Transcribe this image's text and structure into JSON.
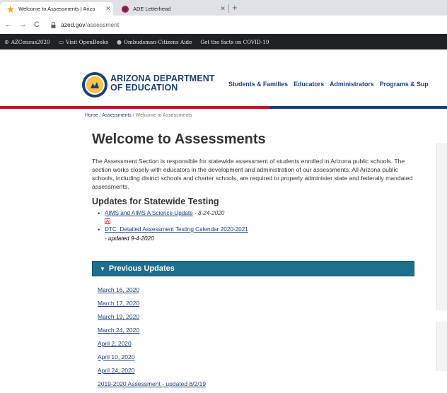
{
  "browser": {
    "tabs": [
      {
        "title": "Welcome to Assessments | Arizo",
        "active": true
      },
      {
        "title": "ADE Letterhead",
        "active": false
      }
    ],
    "url_domain": "azed.gov",
    "url_path": "/assessment",
    "bookmarks": [
      {
        "icon": "globe-icon",
        "label": "AZCensus2020"
      },
      {
        "icon": "book-icon",
        "label": "Visit OpenBooks"
      },
      {
        "icon": "person-icon",
        "label": "Ombudsman-Citizens Aide"
      },
      {
        "icon": "none",
        "label": "Get the facts on COVID-19"
      }
    ]
  },
  "site": {
    "brand_line1": "ARIZONA DEPARTMENT",
    "brand_line2": "OF EDUCATION",
    "nav": [
      "Students & Families",
      "Educators",
      "Administrators",
      "Programs & Sup"
    ]
  },
  "breadcrumb": {
    "home": "Home",
    "sep": "/",
    "assessments": "Assessments",
    "current": "Welcome to Assessments"
  },
  "main": {
    "title": "Welcome to Assessments",
    "intro": "The Assessment Section is responsible for statewide assessment of students enrolled in Arizona public schools. The section works closely with educators in the development and administration of our assessments. All Arizona public schools, including district schools and charter schools, are required to properly administer state and federally mandated assessments.",
    "updates_title": "Updates for Statewide Testing",
    "updates": [
      {
        "link": "AIMS and AIMS A Science Update",
        "date": " - 8-24-2020"
      },
      {
        "link": "DTC_Detailed Assessment Testing Calendar 2020-2021",
        "note": "- updated 9-4-2020"
      }
    ],
    "accordion_label": "Previous Updates",
    "previous_updates": [
      "March 16, 2020",
      "March 17, 2020",
      "March 19, 2020",
      "March 24, 2020",
      "April 2, 2020",
      "April 10, 2020",
      "April 24, 2020",
      "2019-2020 Assessment - updated 8/2/19"
    ]
  },
  "colors": {
    "navy": "#1c3f78",
    "red": "#c8102e",
    "accordion": "#1e6e8d"
  }
}
